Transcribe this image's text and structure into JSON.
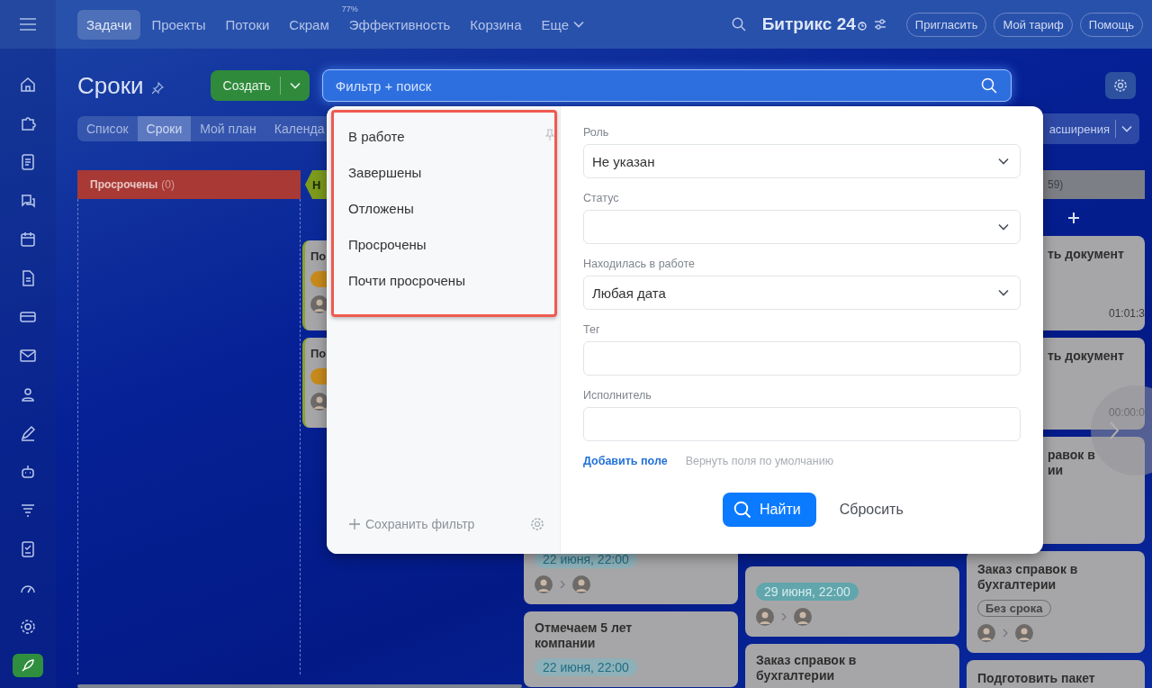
{
  "nav": {
    "tabs": [
      {
        "label": "Задачи",
        "selected": true
      },
      {
        "label": "Проекты",
        "selected": false
      },
      {
        "label": "Потоки",
        "selected": false
      },
      {
        "label": "Скрам",
        "selected": false
      },
      {
        "label": "Эффективность",
        "selected": false,
        "badge": "77%"
      },
      {
        "label": "Корзина",
        "selected": false
      },
      {
        "label": "Еще",
        "selected": false,
        "dropdown": true
      }
    ],
    "logo": "Битрикс 24",
    "buttons": [
      "Пригласить",
      "Мой тариф",
      "Помощь"
    ]
  },
  "page": {
    "title": "Сроки",
    "create_button": "Создать",
    "search": {
      "placeholder": "Фильтр + поиск"
    }
  },
  "views": [
    {
      "label": "Список",
      "selected": false
    },
    {
      "label": "Сроки",
      "selected": true
    },
    {
      "label": "Мой план",
      "selected": false
    },
    {
      "label": "Календа",
      "selected": false
    }
  ],
  "extensions_button": "асширения",
  "board": {
    "columns": [
      {
        "kind": "header",
        "title": "Просрочены",
        "count": "(0)",
        "color": "#a83935"
      },
      {
        "kind": "arrow",
        "title": "Н",
        "color": "#7c9a1c",
        "cards": [
          {
            "title": "По"
          },
          {
            "title": "По"
          }
        ]
      },
      {
        "kind": "lower",
        "cards": [
          {
            "date": "22 июня, 22:00"
          },
          {
            "title": "Отмечаем 5 лет компании",
            "date": "22 июня, 22:00"
          }
        ]
      },
      {
        "kind": "lower",
        "cards": [
          {
            "date": "29 июня, 22:00"
          },
          {
            "title": "Заказ справок в бухгалтерии"
          }
        ]
      },
      {
        "kind": "right",
        "count": "59)",
        "cards": [
          {
            "title": "ть документ",
            "time": "01:01:3"
          },
          {
            "title": "ть документ",
            "time": "00:00:0"
          },
          {
            "title": "равок в ии"
          },
          {
            "title": "Заказ справок в бухгалтерии",
            "deadline": "Без срока"
          },
          {
            "title": "Подготовить пакет"
          }
        ]
      }
    ]
  },
  "filter": {
    "presets": [
      {
        "label": "В работе",
        "pinned": true
      },
      {
        "label": "Завершены",
        "pinned": false
      },
      {
        "label": "Отложены",
        "pinned": false
      },
      {
        "label": "Просрочены",
        "pinned": false
      },
      {
        "label": "Почти просрочены",
        "pinned": false
      }
    ],
    "save_button": "Сохранить фильтр",
    "fields": [
      {
        "kind": "select",
        "label": "Роль",
        "value": "Не указан"
      },
      {
        "kind": "select",
        "label": "Статус"
      },
      {
        "kind": "select",
        "label": "Находилась в работе",
        "value": "Любая дата"
      },
      {
        "kind": "input",
        "label": "Тег"
      },
      {
        "kind": "input",
        "label": "Исполнитель"
      }
    ],
    "add_field": "Добавить поле",
    "reset_fields": "Вернуть поля по умолчанию",
    "find_button": "Найти",
    "reset_button": "Сбросить"
  }
}
